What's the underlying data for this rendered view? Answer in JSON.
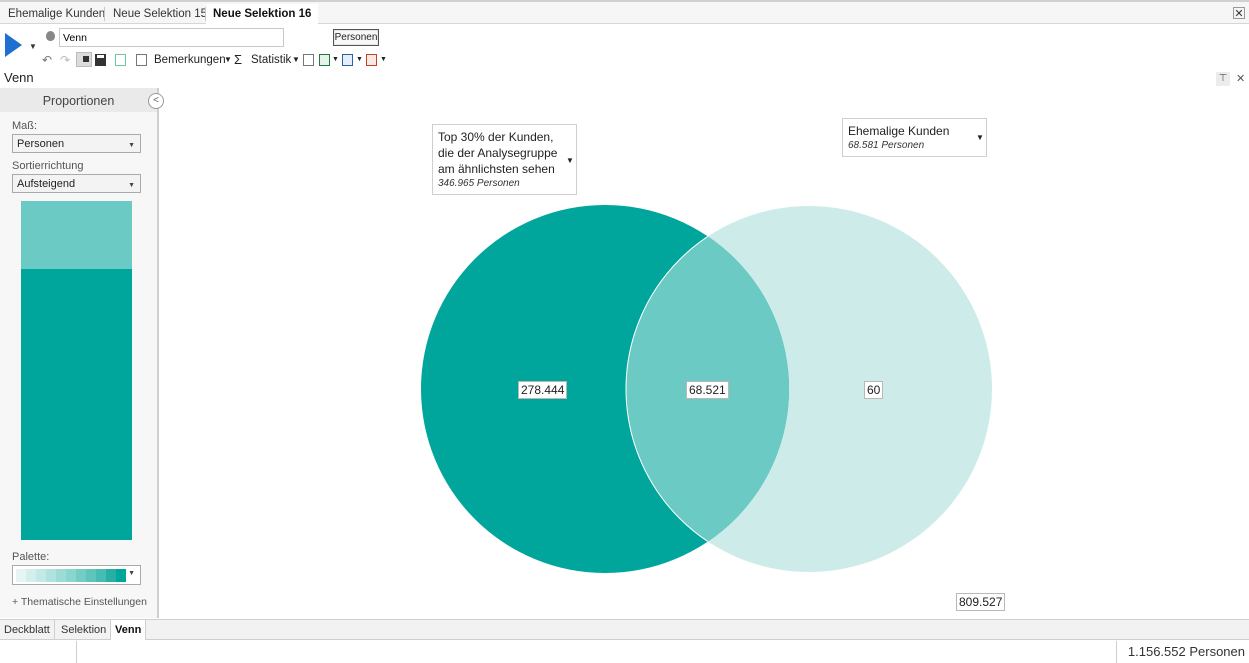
{
  "tabs": [
    {
      "label": "Ehemalige Kunden",
      "active": false
    },
    {
      "label": "Neue Selektion 15",
      "active": false
    },
    {
      "label": "Neue Selektion 16",
      "active": true
    }
  ],
  "tab_close_label": "✕",
  "toolbar": {
    "name_value": "Venn",
    "personen_button": "Personen",
    "remarks_label": "Bemerkungen",
    "statistics_label": "Statistik"
  },
  "section_title": "Venn",
  "left_panel": {
    "header": "Proportionen",
    "measure_label": "Maß:",
    "measure_value": "Personen",
    "sort_label": "Sortierrichtung",
    "sort_value": "Aufsteigend",
    "proportion_fraction_top": 0.2,
    "palette_label": "Palette:",
    "palette_colors": [
      "#e4f5f3",
      "#d3efec",
      "#c2e9e5",
      "#b0e3de",
      "#9ddcd6",
      "#8ad5ce",
      "#74cdc5",
      "#5ec5bc",
      "#46bcb2",
      "#26b0a5",
      "#00a69c"
    ],
    "thematic_settings": "+ Thematische Einstellungen"
  },
  "venn": {
    "left_set": {
      "title_lines": [
        "Top 30% der Kunden,",
        "die der Analysegruppe",
        "am ähnlichsten sehen"
      ],
      "count": "346.965 Personen",
      "color": "#00a69c"
    },
    "right_set": {
      "title_lines": [
        "Ehemalige Kunden"
      ],
      "count": "68.581 Personen",
      "color": "#cdece9"
    },
    "intersection_color": "#6bcac4",
    "left_only_value": "278.444",
    "intersection_value": "68.521",
    "right_only_value": "60",
    "outside_value": "809.527"
  },
  "bottom_tabs": [
    {
      "label": "Deckblatt",
      "active": false
    },
    {
      "label": "Selektion",
      "active": false
    },
    {
      "label": "Venn",
      "active": true
    }
  ],
  "status": {
    "total": "1.156.552 Personen"
  }
}
